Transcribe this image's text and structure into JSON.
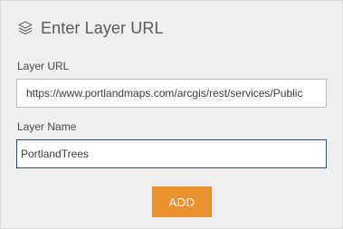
{
  "header": {
    "icon": "layers-icon",
    "title": "Enter Layer URL"
  },
  "layer_url": {
    "label": "Layer URL",
    "value": "https://www.portlandmaps.com/arcgis/rest/services/Public"
  },
  "layer_name": {
    "label": "Layer Name",
    "value": "PortlandTrees"
  },
  "add_button": {
    "label": "ADD"
  },
  "colors": {
    "panel_bg": "#efefef",
    "accent": "#e8912e",
    "focus_border": "#2b4d7a"
  }
}
